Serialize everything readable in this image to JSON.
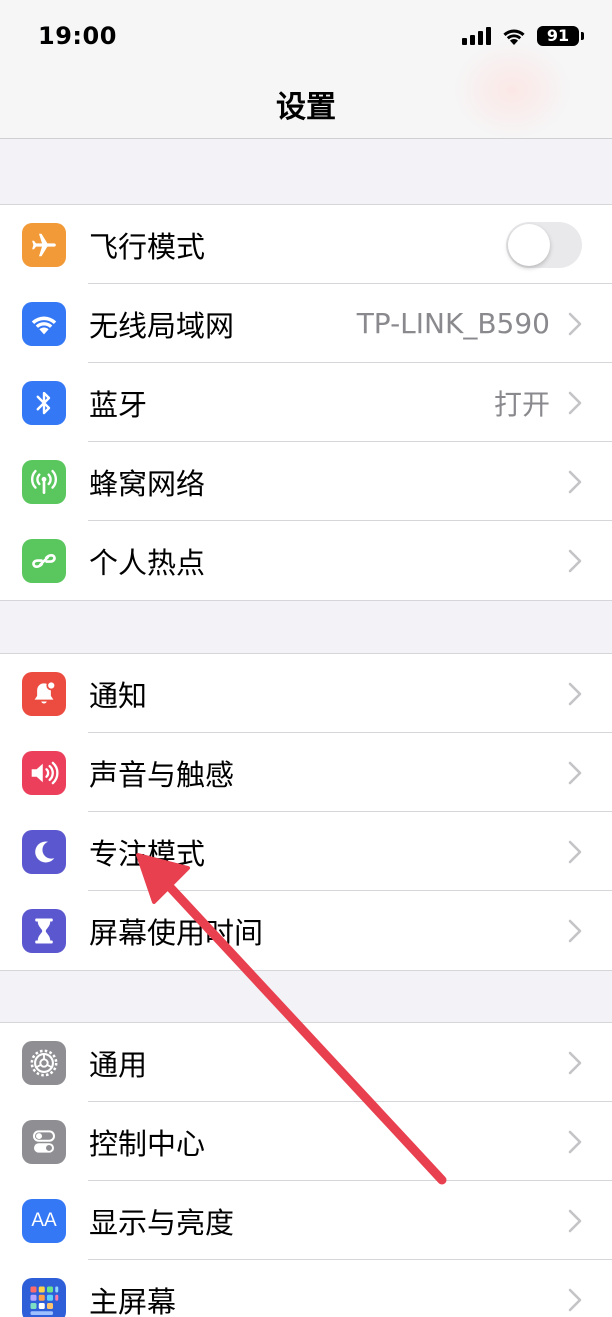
{
  "status_bar": {
    "time": "19:00",
    "battery": "91"
  },
  "nav": {
    "title": "设置"
  },
  "groups": [
    {
      "items": [
        {
          "label": "飞行模式",
          "icon": "airplane-icon",
          "color": "#f29a38",
          "control": "toggle",
          "on": false
        },
        {
          "label": "无线局域网",
          "icon": "wifi-icon",
          "color": "#3478f6",
          "value": "TP-LINK_B590"
        },
        {
          "label": "蓝牙",
          "icon": "bluetooth-icon",
          "color": "#3478f6",
          "value": "打开"
        },
        {
          "label": "蜂窝网络",
          "icon": "antenna-icon",
          "color": "#5ac75e"
        },
        {
          "label": "个人热点",
          "icon": "hotspot-icon",
          "color": "#5ac75e"
        }
      ]
    },
    {
      "items": [
        {
          "label": "通知",
          "icon": "bell-icon",
          "color": "#ec4b3f"
        },
        {
          "label": "声音与触感",
          "icon": "speaker-icon",
          "color": "#ec3f5c"
        },
        {
          "label": "专注模式",
          "icon": "moon-icon",
          "color": "#5b57cf"
        },
        {
          "label": "屏幕使用时间",
          "icon": "hourglass-icon",
          "color": "#5b57cf"
        }
      ]
    },
    {
      "items": [
        {
          "label": "通用",
          "icon": "gear-icon",
          "color": "#8e8e93"
        },
        {
          "label": "控制中心",
          "icon": "switches-icon",
          "color": "#8e8e93"
        },
        {
          "label": "显示与亮度",
          "icon": "text-size-icon",
          "color": "#3478f6",
          "glyph": "AA"
        },
        {
          "label": "主屏幕",
          "icon": "home-grid-icon",
          "color": "#2f5fd8"
        }
      ]
    }
  ],
  "annotation": {
    "color": "#e8404f"
  }
}
